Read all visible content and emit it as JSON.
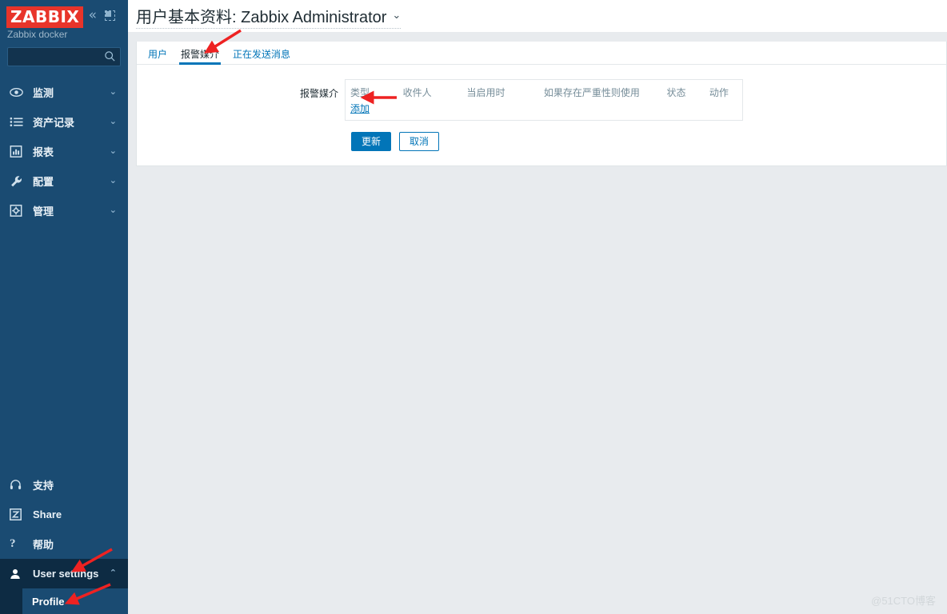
{
  "sidebar": {
    "logo_text": "ZABBIX",
    "server_name": "Zabbix docker",
    "collapse_icon": "«",
    "hide_icon": "hide-sidebar-icon",
    "search": {
      "value": "",
      "placeholder": ""
    },
    "menu": [
      {
        "label": "监测",
        "icon": "eye-icon",
        "chevron": "⌄"
      },
      {
        "label": "资产记录",
        "icon": "list-icon",
        "chevron": "⌄"
      },
      {
        "label": "报表",
        "icon": "bar-chart-icon",
        "chevron": "⌄"
      },
      {
        "label": "配置",
        "icon": "wrench-icon",
        "chevron": "⌄"
      },
      {
        "label": "管理",
        "icon": "gear-icon",
        "chevron": "⌄"
      }
    ],
    "bottom_menu": [
      {
        "label": "支持",
        "icon": "headset-icon"
      },
      {
        "label": "Share",
        "icon": "zabbix-share-icon"
      },
      {
        "label": "帮助",
        "icon": "question-mark-icon"
      }
    ],
    "user_settings": {
      "label": "User settings",
      "icon": "user-icon",
      "chevron": "⌃"
    },
    "user_submenu": [
      {
        "label": "Profile"
      }
    ]
  },
  "header": {
    "title": "用户基本资料: Zabbix Administrator",
    "title_chevron": "⌄"
  },
  "tabs": [
    {
      "label": "用户",
      "active": false
    },
    {
      "label": "报警媒介",
      "active": true
    },
    {
      "label": "正在发送消息",
      "active": false
    }
  ],
  "form": {
    "media_label": "报警媒介",
    "table_headers": [
      "类型",
      "收件人",
      "当启用时",
      "如果存在严重性则使用",
      "状态",
      "动作"
    ],
    "add_link": "添加",
    "buttons": {
      "update": "更新",
      "cancel": "取消"
    }
  },
  "watermark": "@51CTO博客",
  "colors": {
    "sidebar_bg": "#1a4b72",
    "sidebar_dark": "#0d2b43",
    "logo_red": "#e8342a",
    "accent_blue": "#0275b8",
    "page_bg": "#e8ebee",
    "annotation_red": "#ee2222"
  }
}
